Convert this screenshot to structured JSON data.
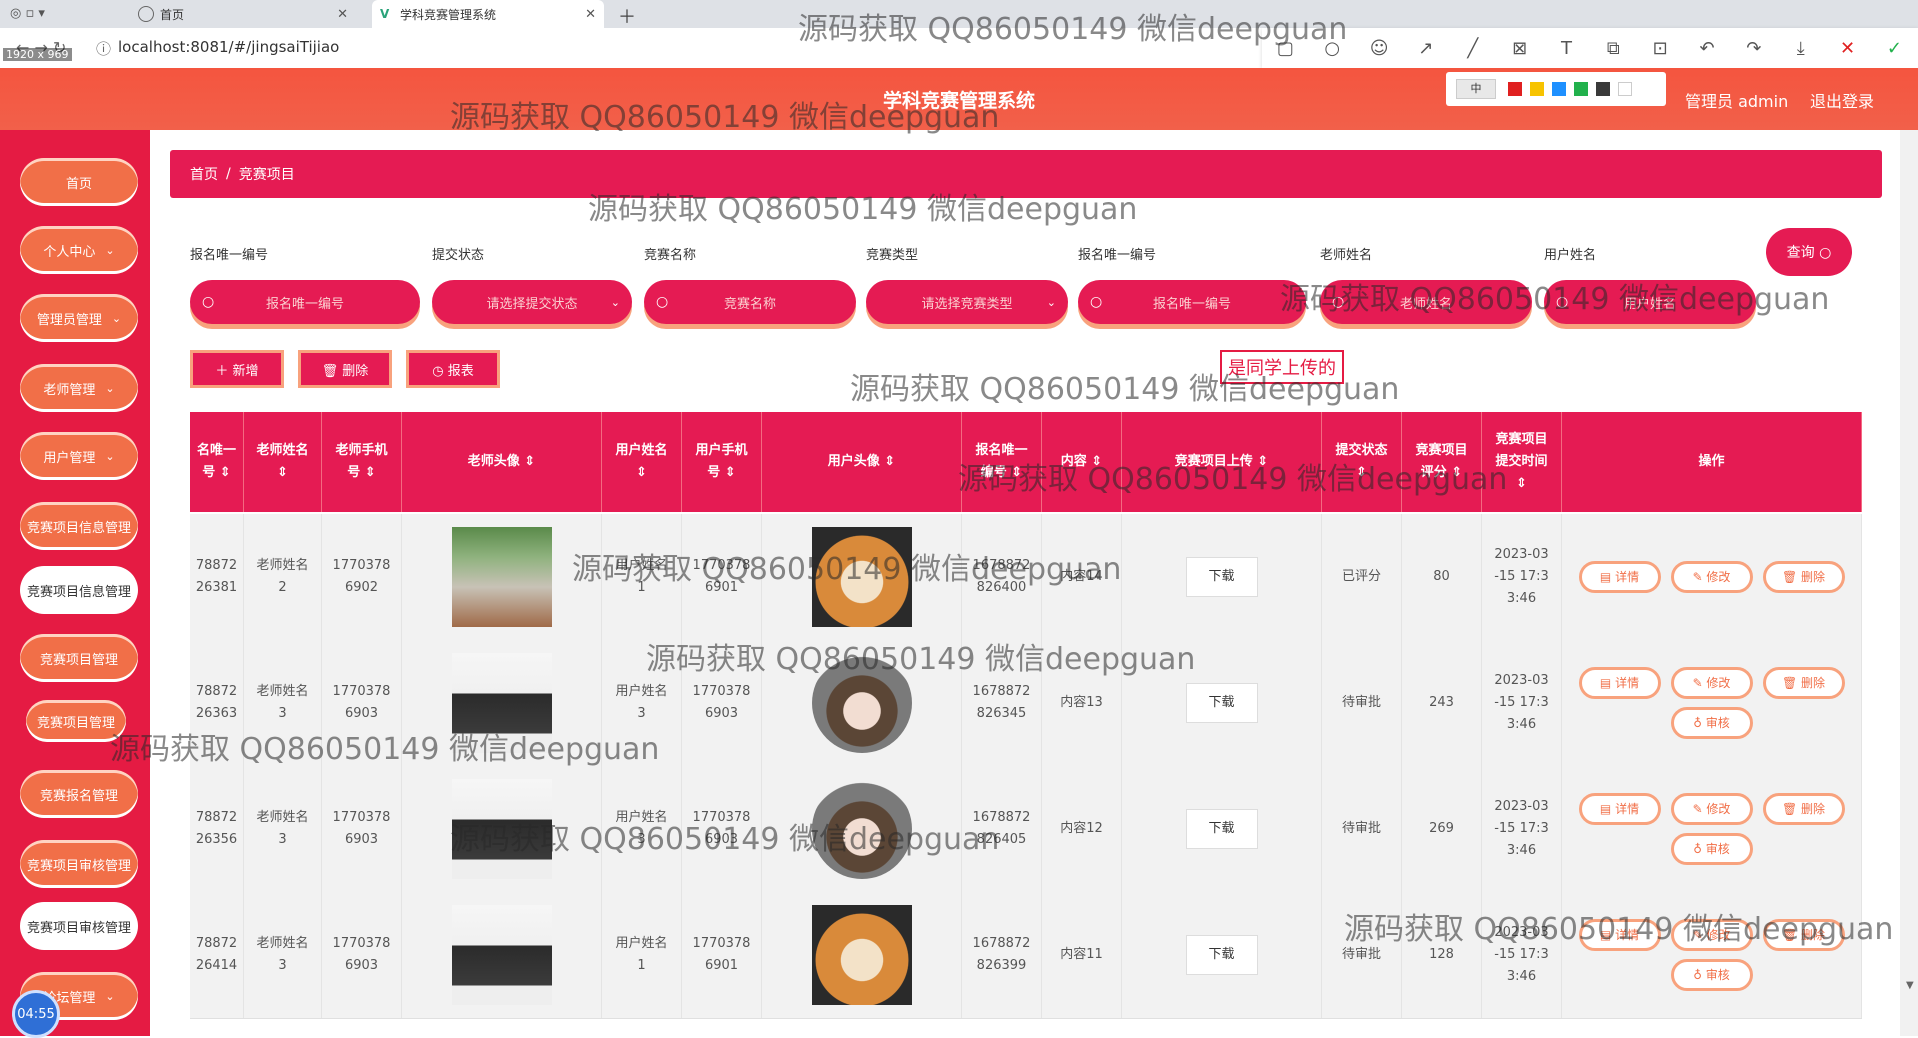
{
  "browser": {
    "tabs": [
      {
        "label": "首页"
      },
      {
        "label": "学科竞赛管理系统"
      }
    ],
    "url": "localhost:8081/#/jingsaiTijiao",
    "screen_dims": "1920 x 969"
  },
  "header": {
    "title": "学科竞赛管理系统",
    "admin": "管理员 admin",
    "logout": "退出登录",
    "palette_size": "中",
    "palette_colors": [
      "#e02020",
      "#f7c300",
      "#1e90ff",
      "#22b14c",
      "#3a3a3a",
      "#ffffff"
    ]
  },
  "sidebar": {
    "items": [
      {
        "label": "首页",
        "chevron": ""
      },
      {
        "label": "个人中心",
        "chevron": "⌄"
      },
      {
        "label": "管理员管理",
        "chevron": "⌄"
      },
      {
        "label": "老师管理",
        "chevron": "⌄"
      },
      {
        "label": "用户管理",
        "chevron": "⌄"
      },
      {
        "label": "竞赛项目信息管理",
        "chevron": ""
      },
      {
        "label": "竞赛项目信息管理",
        "chevron": ""
      },
      {
        "label": "竞赛项目管理",
        "chevron": ""
      },
      {
        "label": "竞赛项目管理",
        "chevron": ""
      },
      {
        "label": "竞赛报名管理",
        "chevron": ""
      },
      {
        "label": "竞赛项目审核管理",
        "chevron": ""
      },
      {
        "label": "竞赛项目审核管理",
        "chevron": ""
      },
      {
        "label": "论坛管理",
        "chevron": "⌄"
      }
    ],
    "clock": "04:55"
  },
  "breadcrumb": {
    "home": "首页",
    "sep": "/",
    "current": "竞赛项目"
  },
  "filters": [
    {
      "label": "报名唯一编号",
      "placeholder": "报名唯一编号",
      "type": "input"
    },
    {
      "label": "提交状态",
      "placeholder": "请选择提交状态",
      "type": "select"
    },
    {
      "label": "竞赛名称",
      "placeholder": "竞赛名称",
      "type": "input"
    },
    {
      "label": "竞赛类型",
      "placeholder": "请选择竞赛类型",
      "type": "select"
    },
    {
      "label": "报名唯一编号",
      "placeholder": "报名唯一编号",
      "type": "input"
    },
    {
      "label": "老师姓名",
      "placeholder": "老师姓名",
      "type": "input"
    },
    {
      "label": "用户姓名",
      "placeholder": "用户姓名",
      "type": "input"
    }
  ],
  "query_button": "查询 ○",
  "actions": {
    "add": "＋ 新增",
    "delete": "🗑 删除",
    "report": "◷ 报表"
  },
  "upload_note": "是同学上传的",
  "table": {
    "columns": [
      "名唯一\n号 ⇕",
      "老师姓名\n⇕",
      "老师手机\n号 ⇕",
      "老师头像 ⇕",
      "用户姓名\n⇕",
      "用户手机\n号 ⇕",
      "用户头像 ⇕",
      "报名唯一\n编号 ⇕",
      "内容 ⇕",
      "竞赛项目上传 ⇕",
      "提交状态\n⇕",
      "竞赛项目\n评分 ⇕",
      "竞赛项目\n提交时间\n⇕",
      "操作"
    ],
    "rows": [
      {
        "id": "78872\n26381",
        "teacher": "老师姓名\n2",
        "tphone": "1770378\n6902",
        "user": "用户姓名\n1",
        "uphone": "1770378\n6901",
        "signup": "1678872\n826400",
        "content": "内容14",
        "download": "下载",
        "status": "已评分",
        "score": "80",
        "time": "2023-03\n-15 17:3\n3:46",
        "ops": [
          "▤ 详情",
          "✎ 修改",
          "🗑 删除"
        ]
      },
      {
        "id": "78872\n26363",
        "teacher": "老师姓名\n3",
        "tphone": "1770378\n6903",
        "user": "用户姓名\n3",
        "uphone": "1770378\n6903",
        "signup": "1678872\n826345",
        "content": "内容13",
        "download": "下载",
        "status": "待审批",
        "score": "243",
        "time": "2023-03\n-15 17:3\n3:46",
        "ops": [
          "▤ 详情",
          "✎ 修改",
          "🗑 删除",
          "♁ 审核"
        ]
      },
      {
        "id": "78872\n26356",
        "teacher": "老师姓名\n3",
        "tphone": "1770378\n6903",
        "user": "用户姓名\n3",
        "uphone": "1770378\n6903",
        "signup": "1678872\n826405",
        "content": "内容12",
        "download": "下载",
        "status": "待审批",
        "score": "269",
        "time": "2023-03\n-15 17:3\n3:46",
        "ops": [
          "▤ 详情",
          "✎ 修改",
          "🗑 删除",
          "♁ 审核"
        ]
      },
      {
        "id": "78872\n26414",
        "teacher": "老师姓名\n3",
        "tphone": "1770378\n6903",
        "user": "用户姓名\n1",
        "uphone": "1770378\n6901",
        "signup": "1678872\n826399",
        "content": "内容11",
        "download": "下载",
        "status": "待审批",
        "score": "128",
        "time": "2023-03\n-15 17:3\n3:46",
        "ops": [
          "▤ 详情",
          "✎ 修改",
          "🗑 删除",
          "♁ 审核"
        ]
      }
    ]
  },
  "watermark": "源码获取 QQ86050149 微信deepguan"
}
